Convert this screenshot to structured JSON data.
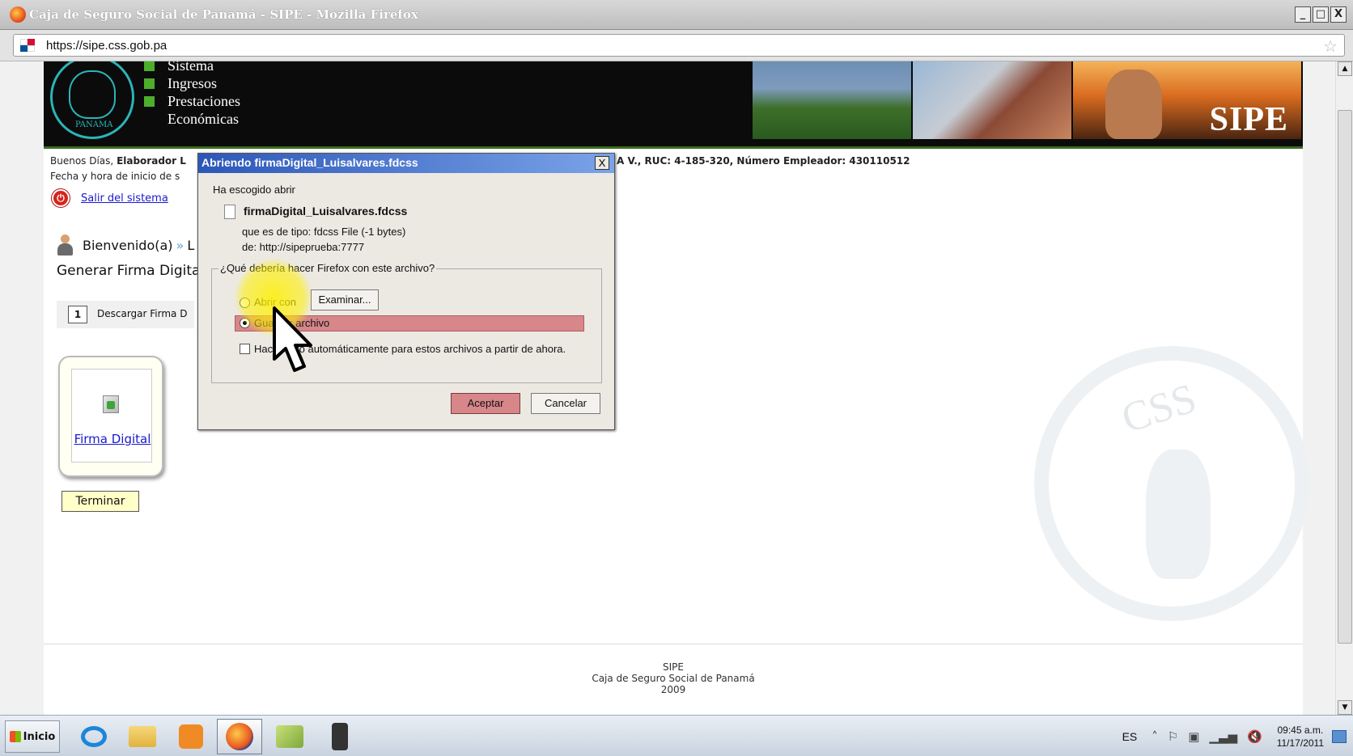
{
  "window": {
    "title": "Caja de Seguro Social de Panamá - SIPE - Mozilla Firefox",
    "minimize": "_",
    "maximize": "□",
    "close": "X"
  },
  "browser": {
    "url": "https://sipe.css.gob.pa"
  },
  "header": {
    "logo_text": "PANAMA",
    "menu": [
      "Sistema",
      "Ingresos",
      "Prestaciones",
      "Económicas"
    ],
    "brand": "SIPE"
  },
  "page": {
    "greeting_prefix": "Buenos Días,",
    "greeting_user": "Elaborador L",
    "greeting_right": "A V., RUC: 4-185-320, Número Empleador: 430110512",
    "session_line": "Fecha y hora de inicio de s",
    "logout_label": "Salir del sistema",
    "welcome_label": "Bienvenido(a)",
    "breadcrumb_sep": "»",
    "breadcrumb_tail": "L",
    "section_title": "Generar Firma Digita",
    "step_number": "1",
    "step_label": "Descargar Firma D",
    "card_link": "Firma Digital",
    "finish_button": "Terminar",
    "watermark": "CSS"
  },
  "footer": {
    "line1": "SIPE",
    "line2": "Caja de Seguro Social de Panamá",
    "line3": "2009"
  },
  "dialog": {
    "title": "Abriendo firmaDigital_Luisalvares.fdcss",
    "close": "X",
    "chose_label": "Ha escogido abrir",
    "file_name": "firmaDigital_Luisalvares.fdcss",
    "file_type": "que es de tipo:  fdcss File (-1 bytes)",
    "file_from": "de:  http://sipeprueba:7777",
    "question": "¿Qué debería hacer Firefox con este archivo?",
    "open_with_label": "Abrir con",
    "browse_button": "Examinar...",
    "save_label": "Guardar archivo",
    "auto_label": "Hacer esto automáticamente para estos archivos a partir de ahora.",
    "ok_button": "Aceptar",
    "cancel_button": "Cancelar",
    "selected_option": "Guardar archivo"
  },
  "taskbar": {
    "start_label": "Inicio",
    "language": "ES",
    "time": "09:45 a.m.",
    "date": "11/17/2011"
  },
  "colors": {
    "highlight": "#d7868a",
    "banner_bg": "#0b0b0b",
    "menu_square": "#4caf2b",
    "link": "#1a1acc"
  }
}
